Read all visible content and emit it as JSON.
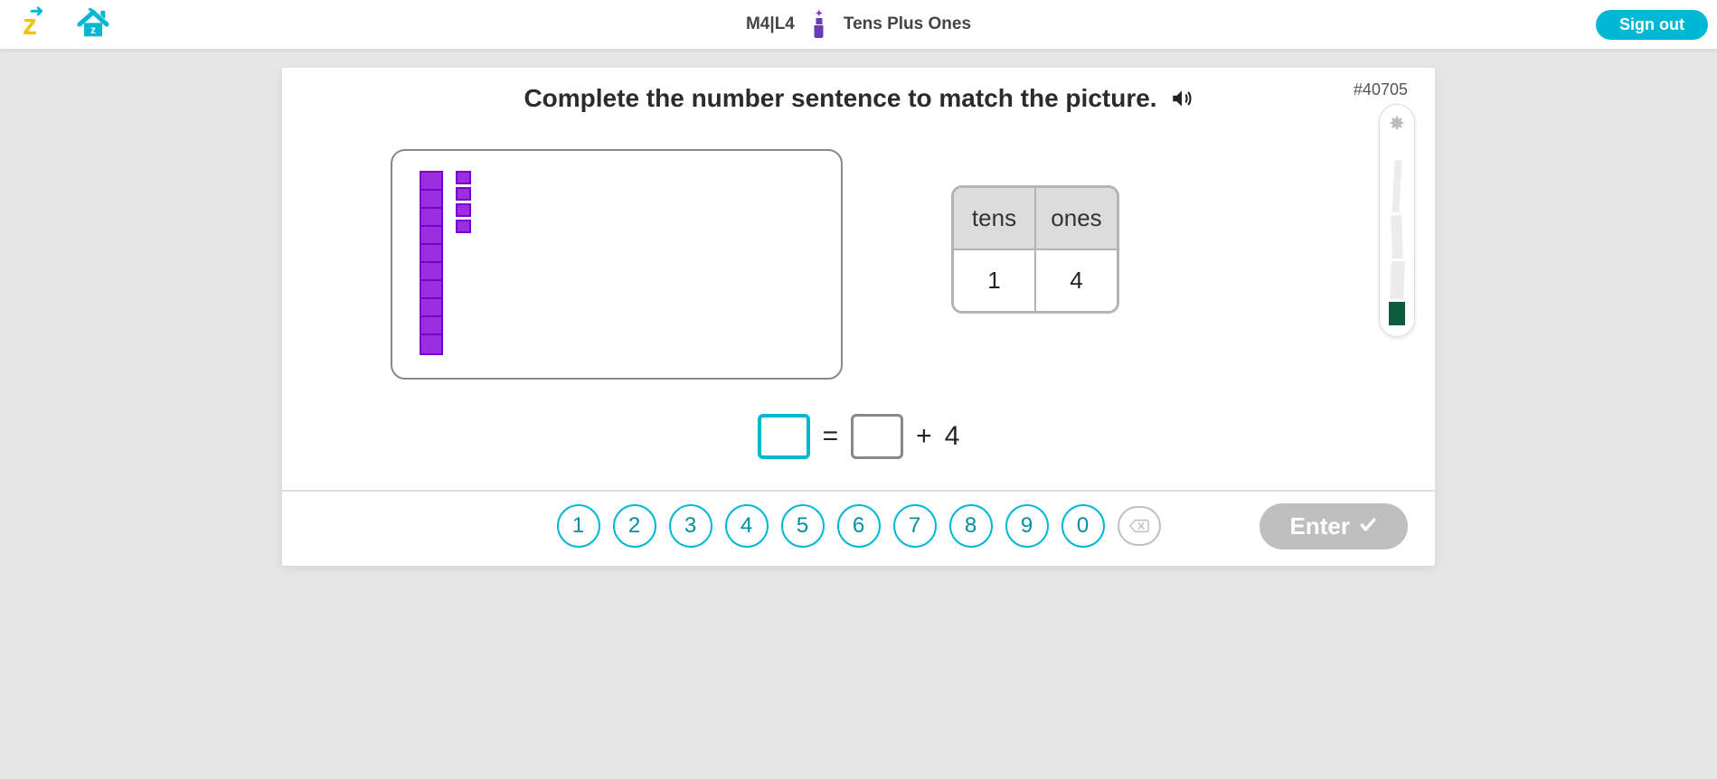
{
  "header": {
    "lesson_code": "M4|L4",
    "lesson_title": "Tens Plus Ones",
    "signout_label": "Sign out"
  },
  "question": {
    "id_label": "#40705",
    "prompt": "Complete the number sentence to match the picture.",
    "tens_blocks": 10,
    "ones_blocks": 4,
    "place_value": {
      "tens_header": "tens",
      "ones_header": "ones",
      "tens_value": "1",
      "ones_value": "4"
    },
    "equation": {
      "equals": "=",
      "plus": "+",
      "addend2": "4"
    }
  },
  "keypad": {
    "digits": [
      "1",
      "2",
      "3",
      "4",
      "5",
      "6",
      "7",
      "8",
      "9",
      "0"
    ],
    "enter_label": "Enter"
  }
}
